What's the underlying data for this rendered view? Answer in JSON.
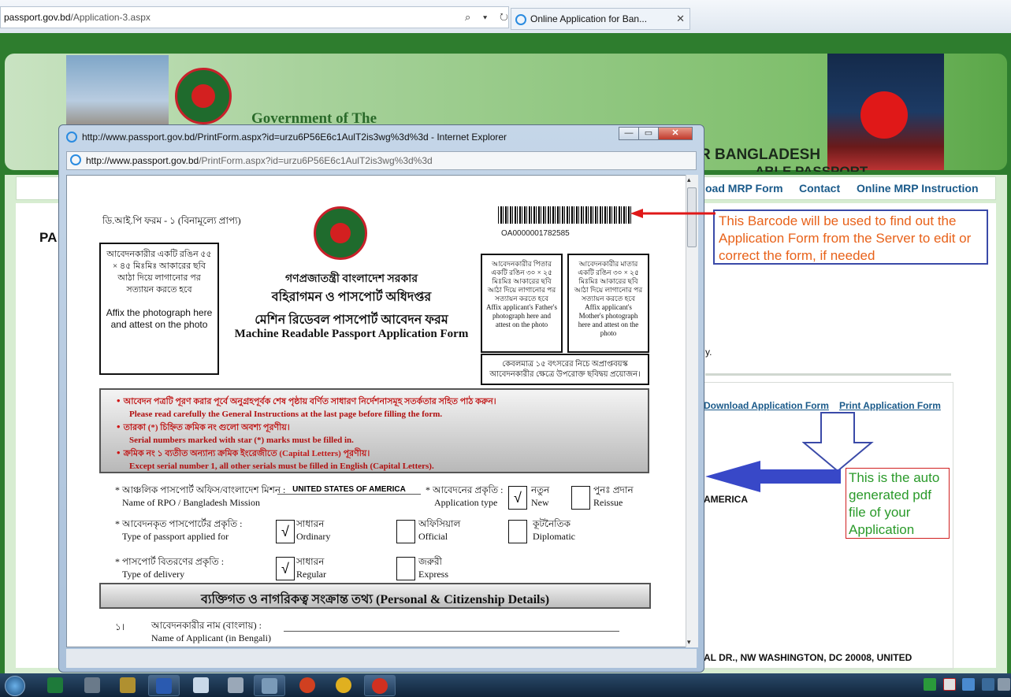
{
  "browser": {
    "address_domain": "passport.gov.bd",
    "address_path": "/Application-3.aspx",
    "address_icons": "⌕ ▾ ↻",
    "tab_title": "Online Application for Ban...",
    "tab_close": "✕"
  },
  "site": {
    "gov_title": "Government of The",
    "bangladesh": "R BANGLADESH",
    "passport_partial": "ABLE PASSPORT",
    "nav": [
      "oad MRP Form",
      "Contact",
      "Online MRP Instruction"
    ],
    "pa": "PA",
    "dot": "y.",
    "links": [
      "Download Application Form",
      "Print Application Form"
    ],
    "america": "AMERICA",
    "address": "AL DR., NW WASHINGTON, DC 20008, UNITED"
  },
  "annotations": {
    "barcode_note": "This Barcode will be used to find out the Application Form from the Server to edit or correct the form, if needed",
    "pdf_note": "This is the auto generated pdf file of your Application"
  },
  "popup": {
    "title": "http://www.passport.gov.bd/PrintForm.aspx?id=urzu6P56E6c1AulT2is3wg%3d%3d - Internet Explorer",
    "address_domain": "http://www.passport.gov.bd",
    "address_path": "/PrintForm.aspx?id=urzu6P56E6c1AulT2is3wg%3d%3d",
    "min": "—",
    "max": "▭",
    "close": "✕"
  },
  "form": {
    "form_no": "ডি.আই.পি ফরম - ১ (বিনামূল্যে প্রাপ্য)",
    "barcode_text": "OA0000001782585",
    "photo_bn": "আবেদনকারীর একটি রঙিন ৫৫ × ৪৫ মিঃমিঃ আকারের ছবি আঠা দিয়ে লাগানোর পর সত্যায়ন করতে হবে",
    "photo_en": "Affix the photograph here and attest on the photo",
    "h1": "গণপ্রজাতন্ত্রী বাংলাদেশ সরকার",
    "h2": "বহিরাগমন ও পাসপোর্ট অধিদপ্তর",
    "h3": "মেশিন রিডেবল পাসপোর্ট আবেদন ফরম",
    "h4": "Machine Readable Passport Application Form",
    "father_bn": "আবেদনকারীর পিতার একটি রঙিন ৩০ × ২৫ মিঃমিঃ আকারের ছবি আঠা দিয়ে লাগানোর পর সত্যায়ন করতে হবে",
    "father_en": "Affix applicant's Father's photograph here and attest on the photo",
    "mother_bn": "আবেদনকারীর মাতার একটি রঙিন ৩০ × ২৫ মিঃমিঃ আকারের ছবি আঠা দিয়ে লাগানোর পর সত্যায়ন করতে হবে",
    "mother_en": "Affix applicant's Mother's photograph here and attest on the photo",
    "under15": "কেবলমাত্র ১৫ বৎসরের নিচে অপ্রাপ্তবয়স্ক আবেদনকারীর ক্ষেত্রে উপরোক্ত ছবিদ্বয় প্রয়োজন।",
    "instr": [
      {
        "bn": "আবেদন পত্রটি পূরণ করার পূর্বে অনুগ্রহপূর্বক শেষ পৃষ্ঠায় বর্ণিত সাধারণ নির্দেশনাসমূহ সতর্কতার সহিত পাঠ করুন।",
        "en": "Please read carefully the General Instructions at  the last page before filling the form."
      },
      {
        "bn": "তারকা (*) চিহ্নিত ক্রমিক নং গুলো অবশ্য পূরণীয়।",
        "en": "Serial numbers marked with star (*) marks must be filled in."
      },
      {
        "bn": "ক্রমিক নং ১ ব্যতীত অন্যান্য ক্রমিক ইংরেজীতে (Capital Letters) পূরণীয়।",
        "en": "Except serial number 1, all other serials must be filled in English  (Capital Letters)."
      }
    ],
    "rpo_bn": "* আঞ্চলিক পাসপোর্ট অফিস/বাংলাদেশ মিশন :",
    "rpo_en": "Name of RPO / Bangladesh Mission",
    "rpo_value": "UNITED STATES OF AMERICA",
    "apptype_bn": "* আবেদনের প্রকৃতি :",
    "apptype_en": "Application type",
    "new_bn": "নতুন",
    "new_en": "New",
    "reissue_bn": "পুনঃ প্রদান",
    "reissue_en": "Reissue",
    "ptype_bn": "* আবেদনকৃত পাসপোর্টের প্রকৃতি :",
    "ptype_en": "Type of passport applied for",
    "ordinary_bn": "সাধারন",
    "ordinary_en": "Ordinary",
    "official_bn": "অফিসিয়াল",
    "official_en": "Official",
    "diplomatic_bn": "কূটনৈতিক",
    "diplomatic_en": "Diplomatic",
    "delivery_bn": "* পাসপোর্ট বিতরণের প্রকৃতি :",
    "delivery_en": "Type of delivery",
    "regular_bn": "সাধারন",
    "regular_en": "Regular",
    "express_bn": "জরুরী",
    "express_en": "Express",
    "check": "√",
    "section": "ব্যক্তিগত ও নাগরিকত্ব সংক্রান্ত তথ্য (Personal & Citizenship Details)",
    "q1_no": "১।",
    "q1_bn": "আবেদনকারীর নাম (বাংলায়) :",
    "q1_en": "Name of Applicant (in Bengali)"
  },
  "scroll": {
    "up": "▴",
    "down": "▾"
  }
}
